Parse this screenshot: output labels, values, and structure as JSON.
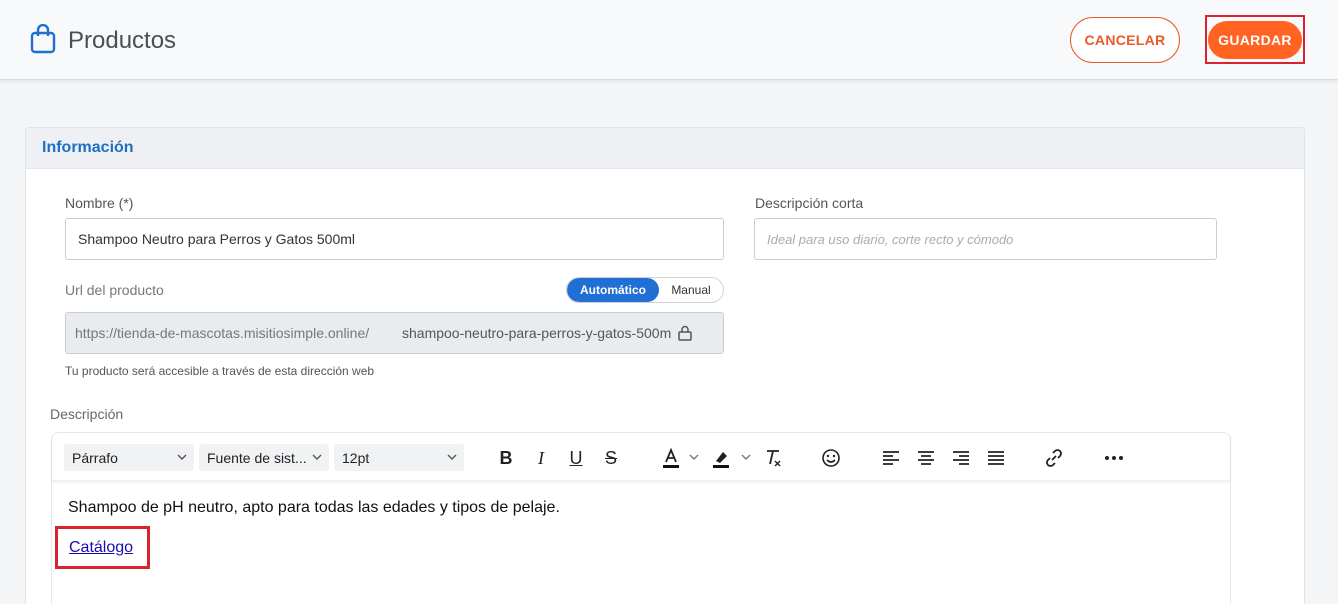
{
  "header": {
    "title": "Productos",
    "cancel_label": "CANCELAR",
    "save_label": "GUARDAR"
  },
  "section": {
    "title": "Información"
  },
  "form": {
    "name_label": "Nombre (*)",
    "name_value": "Shampoo Neutro para Perros y Gatos 500ml",
    "short_desc_label": "Descripción corta",
    "short_desc_placeholder": "Ideal para uso diario, corte recto y cómodo",
    "url_label": "Url del producto",
    "url_mode_auto": "Automático",
    "url_mode_manual": "Manual",
    "url_base": "https://tienda-de-mascotas.misitiosimple.online/",
    "url_slug": "shampoo-neutro-para-perros-y-gatos-500m",
    "url_help": "Tu producto será accesible a través de esta dirección web",
    "description_label": "Descripción"
  },
  "editor": {
    "block_format": "Párrafo",
    "font_family": "Fuente de sist...",
    "font_size": "12pt",
    "body_text": "Shampoo de pH neutro, apto para todas las edades y tipos de pelaje.",
    "link_text": "Catálogo"
  },
  "colors": {
    "accent_orange": "#ff6221",
    "brand_blue": "#1f6fd4",
    "highlight_red": "#d9232d"
  }
}
